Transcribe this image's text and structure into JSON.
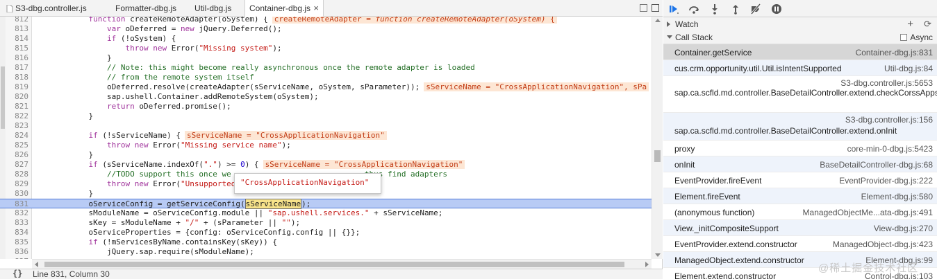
{
  "tabs": [
    {
      "label": "S3-dbg.controller.js",
      "active": false
    },
    {
      "label": "Formatter-dbg.js",
      "active": false
    },
    {
      "label": "Util-dbg.js",
      "active": false
    },
    {
      "label": "Container-dbg.js",
      "active": true
    }
  ],
  "tab_close": "×",
  "editor": {
    "lines": [
      {
        "n": "812",
        "code": "            function createRemoteAdapter(oSystem) {",
        "inline": "createRemoteAdapter = function createRemoteAdapter(oSystem) {"
      },
      {
        "n": "813",
        "code": "                var oDeferred = new jQuery.Deferred();"
      },
      {
        "n": "814",
        "code": "                if (!oSystem) {"
      },
      {
        "n": "815",
        "code": "                    throw new Error(\"Missing system\");"
      },
      {
        "n": "816",
        "code": "                }"
      },
      {
        "n": "817",
        "code": "                // Note: this might become really asynchronous once the remote adapter is loaded"
      },
      {
        "n": "818",
        "code": "                // from the remote system itself"
      },
      {
        "n": "819",
        "code": "                oDeferred.resolve(createAdapter(sServiceName, oSystem, sParameter));",
        "inline": "sServiceName = \"CrossApplicationNavigation\", sPa"
      },
      {
        "n": "820",
        "code": "                sap.ushell.Container.addRemoteSystem(oSystem);"
      },
      {
        "n": "821",
        "code": "                return oDeferred.promise();"
      },
      {
        "n": "822",
        "code": "            }"
      },
      {
        "n": "823",
        "code": ""
      },
      {
        "n": "824",
        "code": "            if (!sServiceName) {",
        "inline": "sServiceName = \"CrossApplicationNavigation\""
      },
      {
        "n": "825",
        "code": "                throw new Error(\"Missing service name\");"
      },
      {
        "n": "826",
        "code": "            }"
      },
      {
        "n": "827",
        "code": "            if (sServiceName.indexOf(\".\") >= 0) {",
        "inline": "sServiceName = \"CrossApplicationNavigation\""
      },
      {
        "n": "828",
        "code": "                //TODO support this once we                             thus find adapters"
      },
      {
        "n": "829",
        "code": "                throw new Error(\"Unsupported"
      },
      {
        "n": "830",
        "code": "            }"
      },
      {
        "n": "831",
        "code": "            oServiceConfig = getServiceConfig(sServiceName);",
        "current": true
      },
      {
        "n": "832",
        "code": "            sModuleName = oServiceConfig.module || \"sap.ushell.services.\" + sServiceName;"
      },
      {
        "n": "833",
        "code": "            sKey = sModuleName + \"/\" + (sParameter || \"\");"
      },
      {
        "n": "834",
        "code": "            oServiceProperties = {config: oServiceConfig.config || {}};"
      },
      {
        "n": "835",
        "code": "            if (!mServicesByName.containsKey(sKey)) {"
      },
      {
        "n": "836",
        "code": "                jQuery.sap.require(sModuleName);"
      },
      {
        "n": "837",
        "code": ""
      }
    ],
    "hover_value": "\"CrossApplicationNavigation\"",
    "status": "Line 831, Column 30",
    "braces": "{}"
  },
  "sidebar": {
    "watch_label": "Watch",
    "watch_add": "+",
    "watch_refresh": "⟳",
    "callstack_label": "Call Stack",
    "async_label": "Async",
    "frames": [
      {
        "name": "Container.getService",
        "loc": "Container-dbg.js:831",
        "selected": true
      },
      {
        "name": "cus.crm.opportunity.util.Util.isIntentSupported",
        "loc": "Util-dbg.js:84"
      },
      {
        "name": "sap.ca.scfld.md.controller.BaseDetailController.extend.checkCorssAppsAvialbleInOffline",
        "loc": "S3-dbg.controller.js:5653",
        "wrap": true
      },
      {
        "name": "sap.ca.scfld.md.controller.BaseDetailController.extend.onInit",
        "loc": "S3-dbg.controller.js:156",
        "wrap": true
      },
      {
        "name": "proxy",
        "loc": "core-min-0-dbg.js:5423"
      },
      {
        "name": "onInit",
        "loc": "BaseDetailController-dbg.js:68"
      },
      {
        "name": "EventProvider.fireEvent",
        "loc": "EventProvider-dbg.js:222"
      },
      {
        "name": "Element.fireEvent",
        "loc": "Element-dbg.js:580"
      },
      {
        "name": "(anonymous function)",
        "loc": "ManagedObjectMe...ata-dbg.js:491"
      },
      {
        "name": "View._initCompositeSupport",
        "loc": "View-dbg.js:270"
      },
      {
        "name": "EventProvider.extend.constructor",
        "loc": "ManagedObject-dbg.js:423"
      },
      {
        "name": "ManagedObject.extend.constructor",
        "loc": "Element-dbg.js:99"
      },
      {
        "name": "Element.extend.constructor",
        "loc": "Control-dbg.js:103"
      }
    ]
  },
  "watermark": "@稀土掘金技术社区",
  "colors": {
    "accent": "#1a73e8",
    "current_line": "#b8cbf5",
    "inline_bg": "#fde6d4"
  }
}
